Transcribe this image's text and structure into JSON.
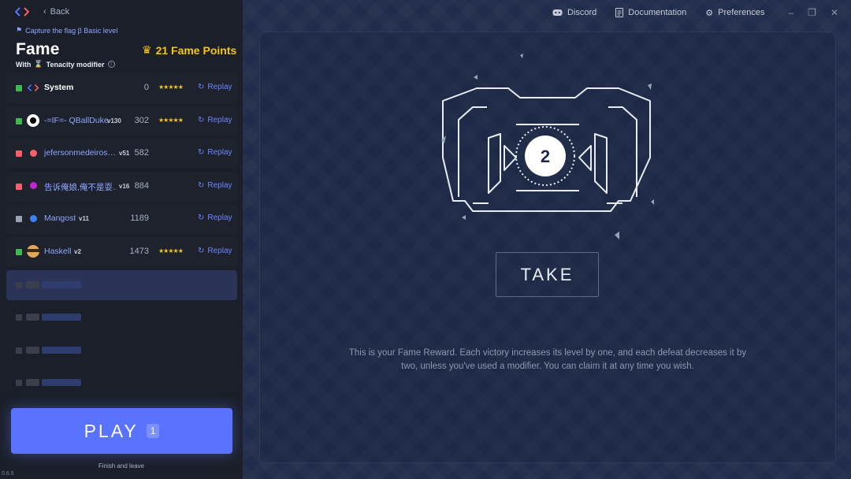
{
  "nav": {
    "back_label": "Back"
  },
  "breadcrumb": {
    "label": "Capture the flag β Basic level"
  },
  "level": {
    "title": "Fame",
    "modifier_prefix": "With",
    "modifier_name": "Tenacity modifier",
    "fame_points": "21 Fame Points"
  },
  "leaderboard": [
    {
      "name": "System",
      "version": "",
      "score": "0",
      "stars": "★★★★★",
      "status_color": "#3fb950",
      "avatar_color": "#5a73ff",
      "replay": "Replay"
    },
    {
      "name": "-=IF=- QBallDuke",
      "version": "v130",
      "score": "302",
      "stars": "★★★★★",
      "status_color": "#3fb950",
      "avatar_color": "#ffffff",
      "replay": "Replay"
    },
    {
      "name": "jefersonmedeiros…",
      "version": "v51",
      "score": "582",
      "stars": "",
      "status_color": "#f85f6a",
      "avatar_color": "#f85f6a",
      "replay": "Replay"
    },
    {
      "name": "告诉俺娘,俺不是耍…",
      "version": "v16",
      "score": "884",
      "stars": "",
      "status_color": "#f85f6a",
      "avatar_color": "#c026d3",
      "replay": "Replay"
    },
    {
      "name": "Mangost",
      "version": "v11",
      "score": "1189",
      "stars": "",
      "status_color": "#9aa1b2",
      "avatar_color": "#3b82f6",
      "replay": "Replay"
    },
    {
      "name": "Haskell",
      "version": "v2",
      "score": "1473",
      "stars": "★★★★★",
      "status_color": "#3fb950",
      "avatar_color": "#e0a85a",
      "replay": "Replay"
    }
  ],
  "play": {
    "label": "PLAY",
    "count": "1",
    "finish_label": "Finish and leave"
  },
  "app": {
    "version": "0.6.5"
  },
  "header": {
    "discord": "Discord",
    "documentation": "Documentation",
    "preferences": "Preferences"
  },
  "reward": {
    "level": "2",
    "take_label": "TAKE",
    "description": "This is your Fame Reward. Each victory increases its level by one, and each defeat decreases it by two, unless you've used a modifier. You can claim it at any time you wish."
  },
  "colors": {
    "accent": "#5a73ff",
    "gold": "#f5c518",
    "link": "#6b86ff"
  }
}
